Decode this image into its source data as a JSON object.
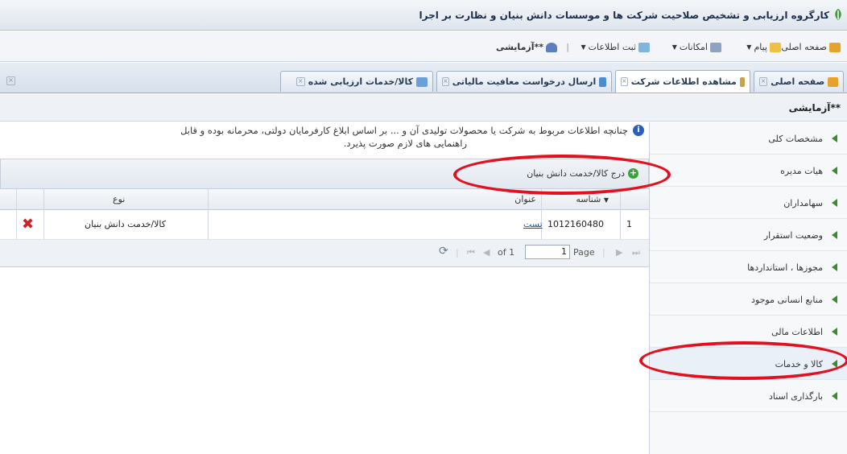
{
  "window": {
    "title": "کارگروه ارزیابی و تشخیص صلاحیت شرکت ها و موسسات دانش بنیان و نظارت بر اجرا"
  },
  "toolbar": {
    "home": "صفحه اصلی",
    "messages": "پیام",
    "facilities": "امکانات",
    "register_info": "ثبت اطلاعات",
    "user": "آزمایشی**"
  },
  "tabs": [
    {
      "label": "صفحه اصلی"
    },
    {
      "label": "مشاهده اطلاعات شرکت"
    },
    {
      "label": "ارسال درخواست معافیت مالیاتی"
    },
    {
      "label": "کالا/خدمات ارزیابی شده"
    }
  ],
  "breadcrumb": {
    "title": "آزمایشی**"
  },
  "sidebar": {
    "items": [
      {
        "label": "مشخصات کلی"
      },
      {
        "label": "هیات مدیره"
      },
      {
        "label": "سهامداران"
      },
      {
        "label": "وضعیت استقرار"
      },
      {
        "label": "مجوزها ، استانداردها"
      },
      {
        "label": "منابع انسانی موجود"
      },
      {
        "label": "اطلاعات مالی"
      },
      {
        "label": "کالا و خدمات"
      },
      {
        "label": "بارگذاری اسناد"
      }
    ]
  },
  "notice": {
    "line1": "چنانچه اطلاعات مربوط به شرکت یا محصولات تولیدی آن و ... بر اساس ابلاغ کارفرمایان دولتی، محرمانه بوده و قابل",
    "line2": "راهنمایی های لازم صورت پذیرد."
  },
  "grid": {
    "add_button": "درج کالا/خدمت دانش بنیان",
    "columns": {
      "id": "شناسه",
      "title": "عنوان",
      "type": "نوع"
    },
    "rows": [
      {
        "num": "1",
        "id": "1012160480",
        "title": "تست",
        "type": "کالا/خدمت دانش بنیان"
      }
    ],
    "pager": {
      "page_label": "Page",
      "page_value": "1",
      "of_label": "of 1"
    }
  },
  "colors": {
    "annotation": "#e3101f",
    "accent": "#3d8b2e"
  }
}
